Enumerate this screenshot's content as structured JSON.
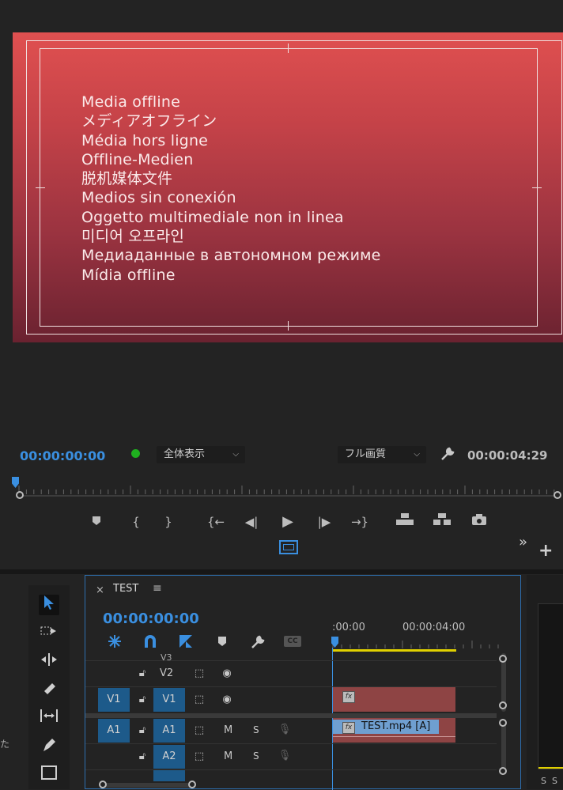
{
  "program_monitor": {
    "offline_lines": [
      "Media offline",
      "メディアオフライン",
      "Média hors ligne",
      "Offline-Medien",
      "脱机媒体文件",
      "Medios sin conexión",
      "Oggetto multimediale non in linea",
      "미디어 오프라인",
      "Медиаданные в автономном режиме",
      "Mídia offline"
    ],
    "current_timecode": "00:00:00:00",
    "zoom_select": "全体表示",
    "quality_select": "フル画質",
    "duration_timecode": "00:00:04:29",
    "status_color": "#1fb01f",
    "accent_color": "#3a8fe0"
  },
  "transport": {
    "buttons": [
      "add-marker",
      "mark-in",
      "mark-out",
      "go-to-in",
      "step-back",
      "play",
      "step-forward",
      "go-to-out",
      "lift",
      "extract",
      "export-frame"
    ],
    "more_label": "»",
    "add_label": "+"
  },
  "timeline": {
    "sequence_name": "TEST",
    "close_label": "×",
    "menu_label": "≡",
    "timecode": "00:00:00:00",
    "ruler_labels": [
      ":00:00",
      "00:00:04:00"
    ],
    "tracks": {
      "v3": "V3",
      "v2": "V2",
      "v1_source": "V1",
      "v1": "V1",
      "a1_source": "A1",
      "a1": "A1",
      "a2": "A2"
    },
    "audio_m": "M",
    "audio_s": "S",
    "audio_clip_label": "TEST.mp4 [A]",
    "fx_label": "fx"
  },
  "left_edge_text": "た",
  "right_panel_labels": [
    "S",
    "S"
  ]
}
